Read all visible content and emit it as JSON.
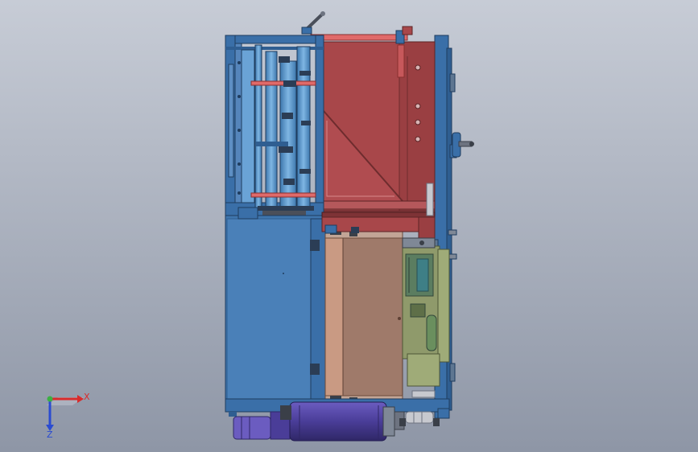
{
  "viewport": {
    "background_top": "#c7ccd6",
    "background_bottom": "#8e96a6"
  },
  "palette": {
    "frame_blue": "#3a6fa8",
    "frame_dark": "#27517f",
    "panel_blue": "#3f75ad",
    "chamber_red": "#a8474a",
    "chamber_dark": "#7e3336",
    "roller_blue": "#5b9bd1",
    "rod_red": "#e06a6a",
    "door_tan": "#c99a83",
    "door_brown": "#9f7a6a",
    "olive": "#8f9a6b",
    "motor_purple": "#5d4ea8",
    "motor_dark": "#3b3278",
    "teal": "#3e7f86"
  },
  "axis_triad": {
    "x_label": "X",
    "z_label": "Z",
    "x_color": "#d92b2b",
    "z_color": "#2a4bd1",
    "origin_color": "#3cb043"
  }
}
